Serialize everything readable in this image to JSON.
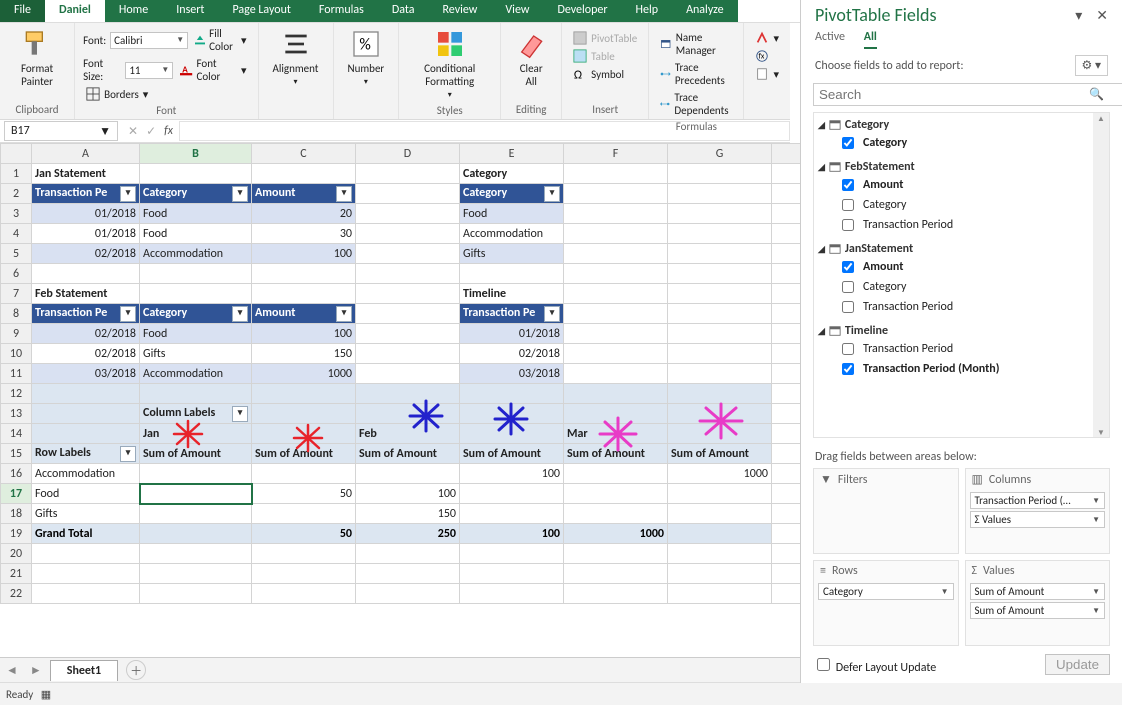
{
  "tabs": [
    "File",
    "Daniel",
    "Home",
    "Insert",
    "Page Layout",
    "Formulas",
    "Data",
    "Review",
    "View",
    "Developer",
    "Help",
    "Analyze"
  ],
  "active_tab": "Daniel",
  "ribbon": {
    "format_painter": "Format Painter",
    "group_clipboard": "Clipboard",
    "font_label": "Font:",
    "font_value": "Calibri",
    "size_label": "Font Size:",
    "size_value": "11",
    "borders_label": "Borders",
    "fill_label": "Fill Color",
    "fontcolor_label": "Font Color",
    "group_font": "Font",
    "alignment": "Alignment",
    "number": "Number",
    "cond": "Conditional Formatting",
    "group_styles": "Styles",
    "clear": "Clear All",
    "group_editing": "Editing",
    "pivot": "PivotTable",
    "table": "Table",
    "symbol": "Symbol",
    "group_insert": "Insert",
    "name_mgr": "Name Manager",
    "trace_prec": "Trace Precedents",
    "trace_dep": "Trace Dependents",
    "group_formulas": "Formulas"
  },
  "name_box": "B17",
  "columns": [
    "A",
    "B",
    "C",
    "D",
    "E",
    "F",
    "G"
  ],
  "sheet_name": "Sheet1",
  "status": "Ready",
  "cells": {
    "A1": "Jan Statement",
    "A2": "Transaction Pe",
    "B2": "Category",
    "C2": "Amount",
    "A3": "01/2018",
    "B3": "Food",
    "C3": "20",
    "A4": "01/2018",
    "B4": "Food",
    "C4": "30",
    "A5": "02/2018",
    "B5": "Accommodation",
    "C5": "100",
    "A7": "Feb Statement",
    "A8": "Transaction Pe",
    "B8": "Category",
    "C8": "Amount",
    "A9": "02/2018",
    "B9": "Food",
    "C9": "100",
    "A10": "02/2018",
    "B10": "Gifts",
    "C10": "150",
    "A11": "03/2018",
    "B11": "Accommodation",
    "C11": "1000",
    "E1": "Category",
    "E2": "Category",
    "E3": "Food",
    "E4": "Accommodation",
    "E5": "Gifts",
    "E7": "Timeline",
    "E8": "Transaction Pe",
    "E9": "01/2018",
    "E10": "02/2018",
    "E11": "03/2018",
    "B13": "Column Labels",
    "B14": "Jan",
    "D14": "Feb",
    "F14": "Mar",
    "A15": "Row Labels",
    "B15": "Sum of Amount",
    "C15": "Sum of Amount",
    "D15": "Sum of Amount",
    "E15": "Sum of Amount",
    "F15": "Sum of Amount",
    "G15": "Sum of Amount",
    "A16": "Accommodation",
    "E16": "100",
    "G16": "1000",
    "A17": "Food",
    "C17": "50",
    "D17": "100",
    "A18": "Gifts",
    "D18": "150",
    "A19": "Grand Total",
    "C19": "50",
    "D19": "250",
    "E19": "100",
    "F19": "1000"
  },
  "side": {
    "title": "PivotTable Fields",
    "tab_active": "Active",
    "tab_all": "All",
    "hint": "Choose fields to add to report:",
    "search_ph": "Search",
    "drag_hint": "Drag fields between areas below:",
    "filters": "Filters",
    "columns": "Columns",
    "rows": "Rows",
    "values": "Values",
    "col_pill1": "Transaction Period (…",
    "col_pill2": "Σ  Values",
    "row_pill": "Category",
    "val_pill1": "Sum of Amount",
    "val_pill2": "Sum of Amount",
    "defer": "Defer Layout Update",
    "update": "Update",
    "groups": {
      "Category": {
        "items": [
          {
            "l": "Category",
            "c": true,
            "b": true
          }
        ]
      },
      "FebStatement": {
        "items": [
          {
            "l": "Amount",
            "c": true,
            "b": true
          },
          {
            "l": "Category",
            "c": false,
            "b": false
          },
          {
            "l": "Transaction Period",
            "c": false,
            "b": false
          }
        ]
      },
      "JanStatement": {
        "items": [
          {
            "l": "Amount",
            "c": true,
            "b": true
          },
          {
            "l": "Category",
            "c": false,
            "b": false
          },
          {
            "l": "Transaction Period",
            "c": false,
            "b": false
          }
        ]
      },
      "Timeline": {
        "items": [
          {
            "l": "Transaction Period",
            "c": false,
            "b": false
          },
          {
            "l": "Transaction Period (Month)",
            "c": true,
            "b": true
          }
        ]
      }
    }
  }
}
